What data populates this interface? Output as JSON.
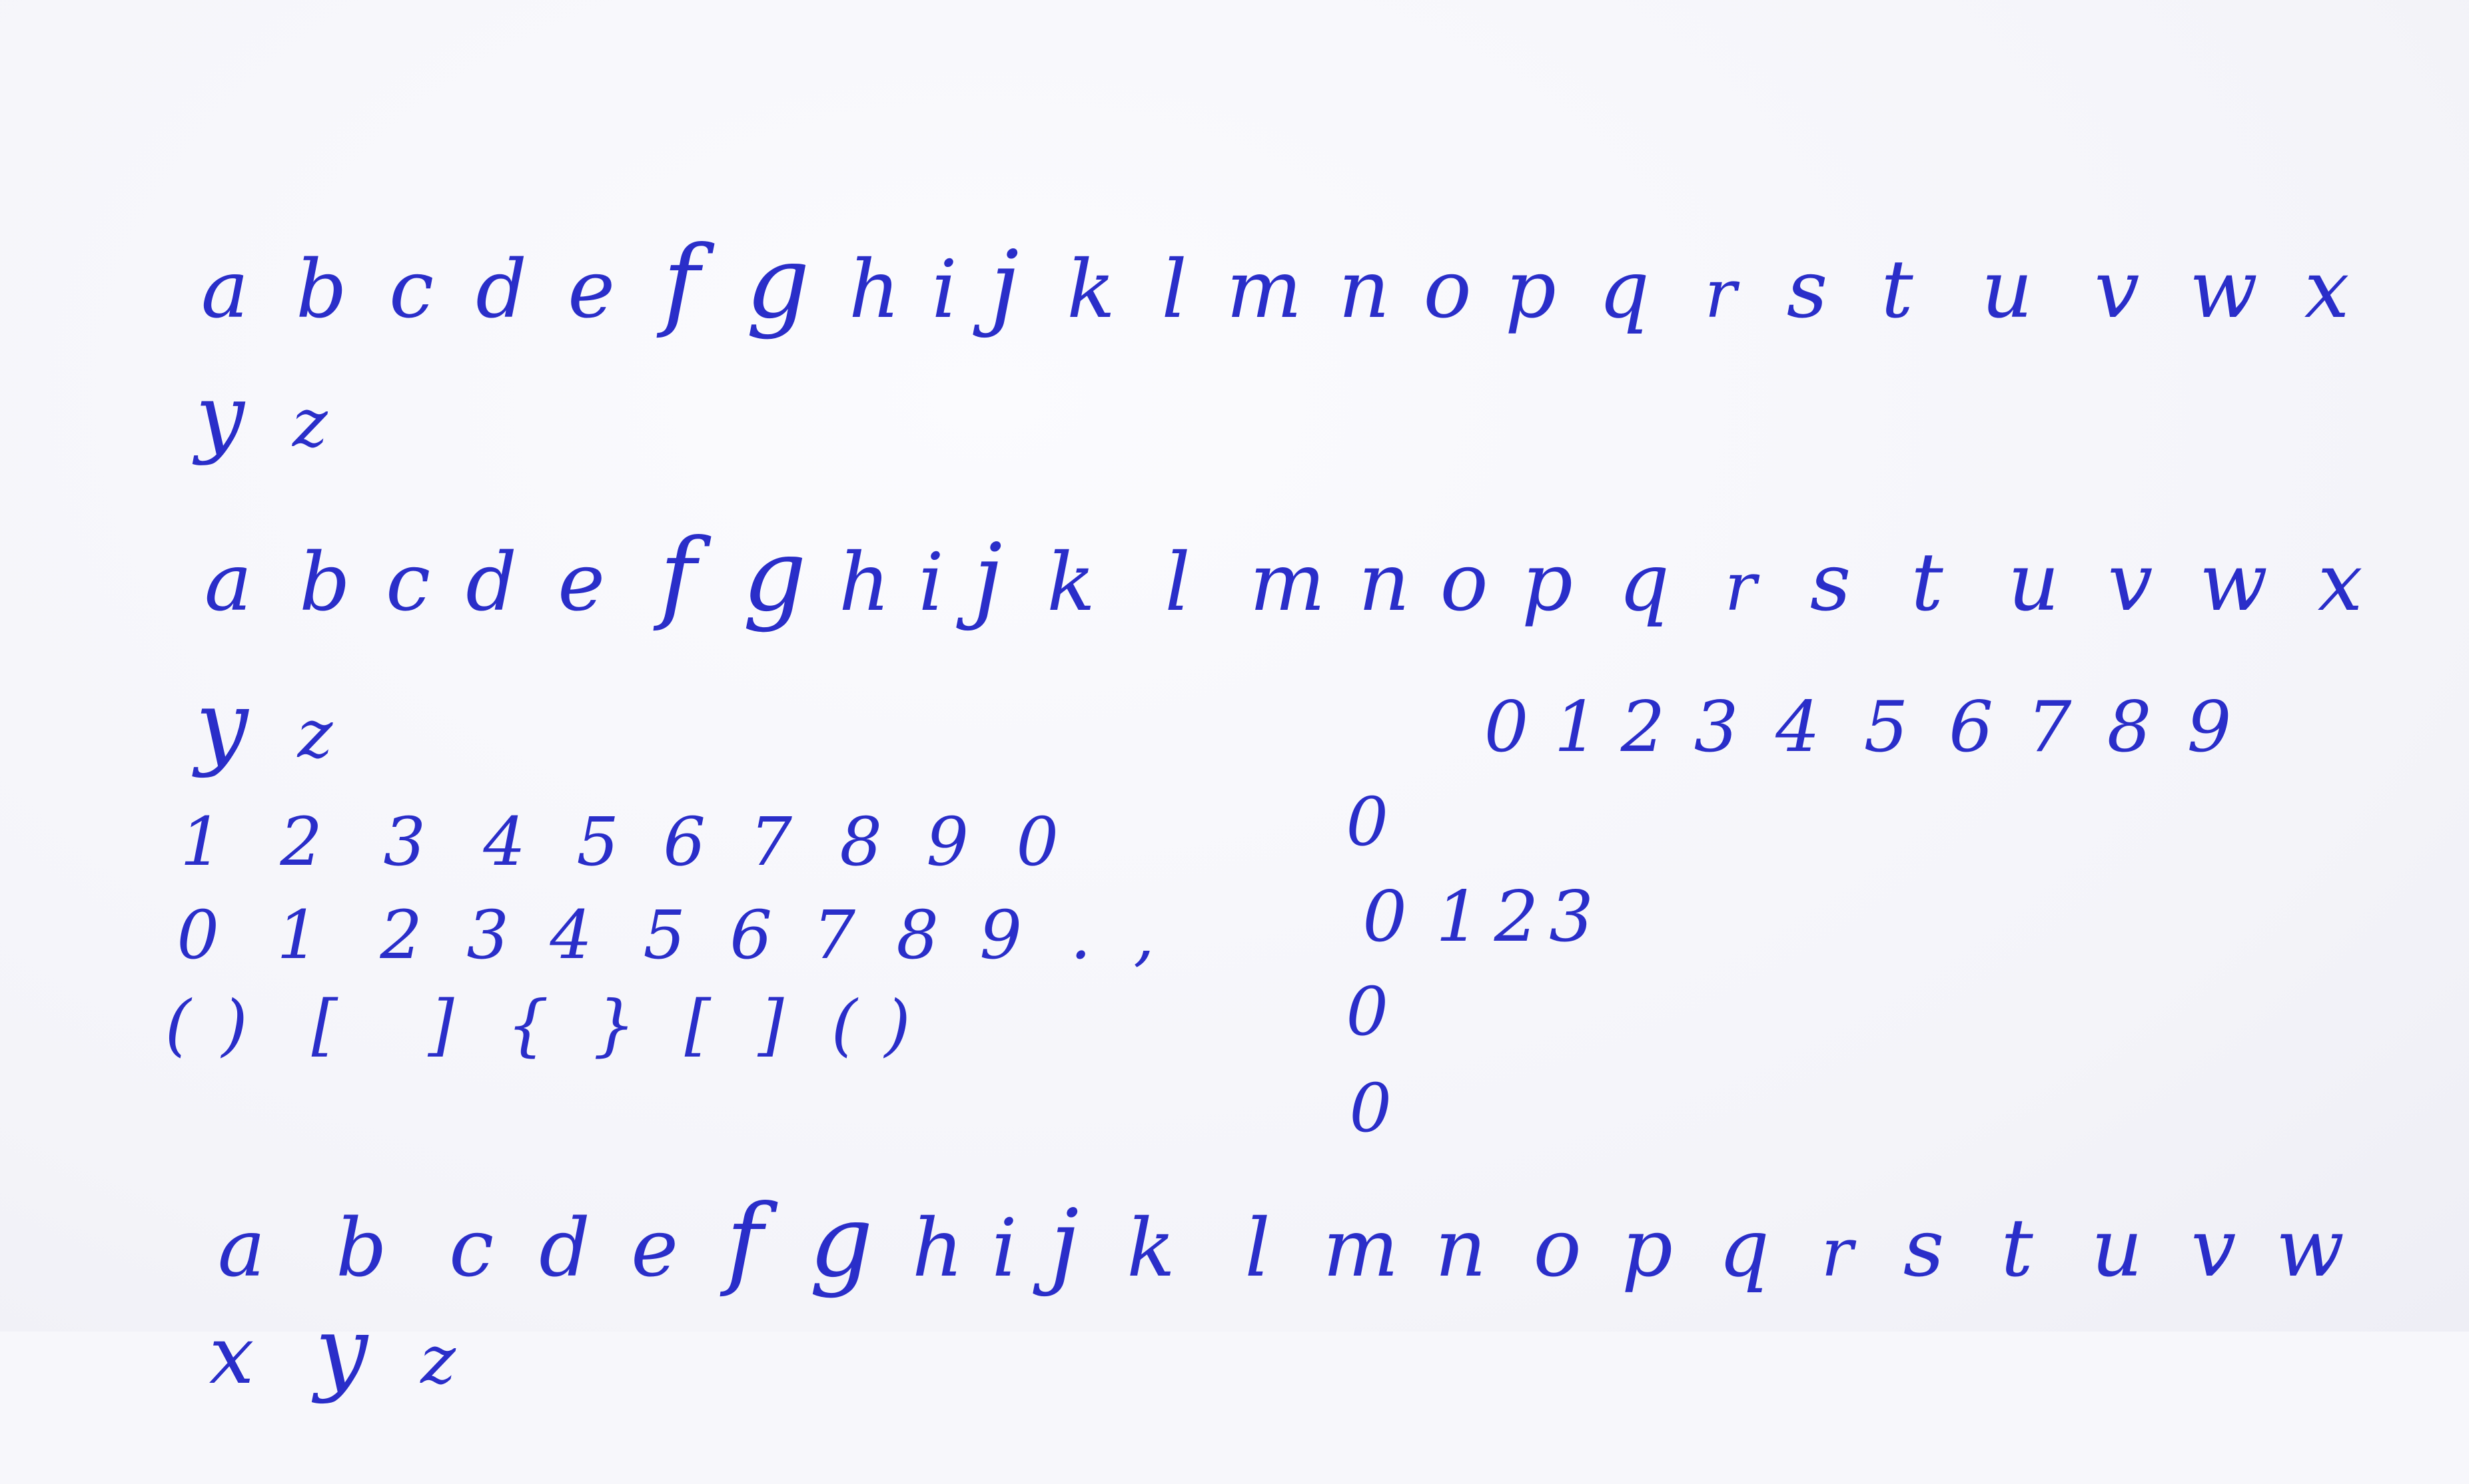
{
  "alphabet_block_1": {
    "line_1": [
      "a",
      "b",
      "c",
      "d",
      "e",
      "f",
      "g",
      "h",
      "i",
      "j",
      "k",
      "l",
      "m",
      "n",
      "o",
      "p",
      "q",
      "r",
      "s",
      "t",
      "u",
      "v",
      "w",
      "x"
    ],
    "line_2": [
      "y",
      "z"
    ]
  },
  "alphabet_block_2": {
    "line_1": [
      "a",
      "b",
      "c",
      "d",
      "e",
      "f",
      "g",
      "h",
      "i",
      "j",
      "k",
      "l",
      "m",
      "n",
      "o",
      "p",
      "q",
      "r",
      "s",
      "t",
      "u",
      "v",
      "w",
      "x"
    ],
    "line_2": [
      "y",
      "z"
    ]
  },
  "digits_right": [
    "0",
    "1",
    "2",
    "3",
    "4",
    "5",
    "6",
    "7",
    "8",
    "9"
  ],
  "numbers_left": {
    "row_1": [
      "1",
      "2",
      "3",
      "4",
      "5",
      "6",
      "7",
      "8",
      "9",
      "0"
    ],
    "row_2": [
      "0",
      "1",
      "2",
      "3",
      "4",
      "5",
      "6",
      "7",
      "8",
      "9",
      ".",
      ","
    ],
    "row_3": [
      "(",
      ")",
      "[",
      "]",
      "{",
      "}",
      "[",
      "]",
      "(",
      ")"
    ]
  },
  "zero_column": {
    "row_1": "0",
    "row_2": [
      "0",
      "1",
      "2",
      "3"
    ],
    "row_3": "0",
    "row_4": "0"
  },
  "alphabet_block_3": {
    "line_1": [
      "a",
      "b",
      "c",
      "d",
      "e",
      "f",
      "g",
      "h",
      "i",
      "j",
      "k",
      "l",
      "m",
      "n",
      "o",
      "p",
      "q",
      "r",
      "s",
      "t",
      "u",
      "v",
      "w"
    ],
    "line_2": [
      "x",
      "y",
      "z"
    ]
  },
  "colors": {
    "ink": "#2a2ec9",
    "paper": "#f7f7fb"
  }
}
